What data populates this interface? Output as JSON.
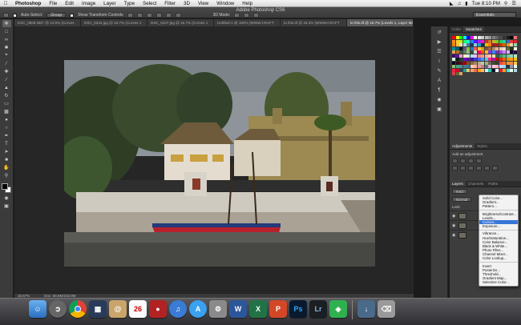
{
  "menubar": {
    "app": "Photoshop",
    "items": [
      "File",
      "Edit",
      "Image",
      "Layer",
      "Type",
      "Select",
      "Filter",
      "3D",
      "View",
      "Window",
      "Help"
    ],
    "clock": "Tue 8:10 PM"
  },
  "optionsbar": {
    "window_title": "Adobe Photoshop CS6",
    "auto_select_label": "Auto-Select:",
    "auto_select_value": "Group",
    "show_transform_label": "Show Transform Controls",
    "mode_label": "3D Mode:",
    "workspace": "Essentials"
  },
  "tabs": [
    {
      "label": "DSC_0808.NEF @ 12.5% (Curves"
    },
    {
      "label": "DSC_0343.jpg @ 16.7% (Curves 1"
    },
    {
      "label": "DSC_0437.jpg @ 16.7% (Curves 1"
    },
    {
      "label": "Untitled-1 @ 100% (WWW.CRAFT"
    },
    {
      "label": "to this.tif @ 33.3% (WWW.CRAFT"
    },
    {
      "label": "to this.tif @ 16.7% (Levels 1, Layer Mask/8)"
    }
  ],
  "status": {
    "zoom": "16.67%",
    "doc": "Doc: 68.6M/233.9M"
  },
  "panels": {
    "color_tab": "Color",
    "swatches_tab": "Swatches",
    "swatch_colors": [
      "#ff0000",
      "#ffff00",
      "#00ff00",
      "#00ffff",
      "#0000ff",
      "#ff00ff",
      "#ffffff",
      "#e6e6e6",
      "#cccccc",
      "#b3b3b3",
      "#999999",
      "#808080",
      "#666666",
      "#4d4d4d",
      "#333333",
      "#1a1a1a",
      "#000000",
      "#ff6b6b",
      "#ff8c1a",
      "#ffd11a",
      "#b3ff1a",
      "#1aff66",
      "#1affd9",
      "#1a8cff",
      "#4d1aff",
      "#b31aff",
      "#ff1ab3",
      "#cc3333",
      "#cc7a29",
      "#ccb229",
      "#7acc29",
      "#29cc52",
      "#29ccb2",
      "#2970cc",
      "#e63946",
      "#d62828",
      "#f77f00",
      "#fcbf49",
      "#eae2b7",
      "#a8dadc",
      "#457b9d",
      "#1d3557",
      "#8ecae6",
      "#219ebc",
      "#023047",
      "#ffb703",
      "#fb8500",
      "#9b2226",
      "#ae2012",
      "#bb3e03",
      "#ca6702",
      "#ee9b00",
      "#e9d8a6",
      "#94d2bd",
      "#0a9396",
      "#005f73",
      "#001219",
      "#6a4c93",
      "#8ac926",
      "#1982c4",
      "#ff595e",
      "#ffca3a",
      "#c9a227",
      "#7f5539",
      "#9c6644",
      "#b08968",
      "#ddb892",
      "#e6ccb2",
      "#ede0d4",
      "#606c38",
      "#283618",
      "#fefae0",
      "#dda15e",
      "#bc6c25",
      "#3a5a40",
      "#588157",
      "#a3b18a",
      "#344e41",
      "#dad7cd",
      "#ff006e",
      "#fb5607",
      "#ffbe0b",
      "#8338ec",
      "#3a86ff",
      "#7b2cbf",
      "#9d4edd",
      "#c77dff",
      "#e0aaff",
      "#10002b",
      "#240046",
      "#3c096c",
      "#5a189a",
      "#ff99c8",
      "#fcf6bd",
      "#d0f4de",
      "#a9def9",
      "#e4c1f9",
      "#f08080",
      "#f4978e",
      "#f8ad9d",
      "#fbc4ab",
      "#ffdab9",
      "#2d6a4f",
      "#40916c",
      "#52b788",
      "#74c69d",
      "#95d5b2",
      "#b7e4c7",
      "#d8f3dc",
      "#081c15",
      "#1b4332",
      "#7209b7",
      "#560bad",
      "#480ca8",
      "#3f37c9",
      "#4361ee",
      "#4895ef",
      "#4cc9f0",
      "#f72585",
      "#b5179e",
      "#d00000",
      "#dc2f02",
      "#e85d04",
      "#f48c06",
      "#faa307",
      "#ffba08",
      "#03071e",
      "#370617",
      "#6a040f",
      "#9d0208",
      "#7f4f24",
      "#936639",
      "#a68a64",
      "#b6ad90",
      "#c2c5aa",
      "#a4ac86",
      "#656d4a",
      "#414833",
      "#333d29",
      "#f94144",
      "#f3722c",
      "#f8961e",
      "#f9844a",
      "#f9c74f",
      "#90be6d",
      "#43aa8b",
      "#4d908e",
      "#577590",
      "#277da1",
      "#ffcdb2",
      "#ffb4a2",
      "#e5989b",
      "#b5838d",
      "#6d6875",
      "#cdb4db",
      "#ffc8dd",
      "#ffafcc",
      "#bde0fe",
      "#a2d2ff",
      "#2b2d42",
      "#8d99ae",
      "#edf2f4",
      "#ef233c",
      "#d90429",
      "#264653",
      "#2a9d8f",
      "#e9c46a",
      "#f4a261",
      "#e76f51",
      "#ff9f1c",
      "#ffbf69",
      "#cbf3f0",
      "#2ec4b6",
      "#011627",
      "#fdfffc",
      "#e71d36",
      "#ff9f1c",
      "#41ead4",
      "#f1faee",
      "#a8dadc",
      "#e63946",
      "#606c38",
      "#dda15e"
    ],
    "adjustments_tab": "Adjustments",
    "styles_tab": "Styles",
    "add_adjustment": "Add an adjustment",
    "layers_tab": "Layers",
    "channels_tab": "Channels",
    "paths_tab": "Paths",
    "kind_label": "Kind",
    "blend_mode": "Normal",
    "lock_label": "Lock:"
  },
  "adj_menu": {
    "groups": [
      [
        "Solid Color...",
        "Gradient...",
        "Pattern..."
      ],
      [
        "Brightness/Contrast...",
        "Levels...",
        "Curves...",
        "Exposure..."
      ],
      [
        "Vibrance...",
        "Hue/Saturation...",
        "Color Balance...",
        "Black & White...",
        "Photo Filter...",
        "Channel Mixer...",
        "Color Lookup..."
      ],
      [
        "Invert",
        "Posterize...",
        "Threshold...",
        "Gradient Map...",
        "Selective Color..."
      ]
    ],
    "highlighted": "Curves..."
  },
  "dock": {
    "calendar_day": "26",
    "apps": [
      "Finder",
      "Launchpad",
      "Chrome",
      "Mission Control",
      "Contacts",
      "Calendar",
      "Photo Booth",
      "iTunes",
      "App Store",
      "System Preferences",
      "Word",
      "Excel",
      "PowerPoint",
      "Photoshop",
      "Lightroom",
      "Evernote",
      "Downloads",
      "Trash"
    ]
  }
}
